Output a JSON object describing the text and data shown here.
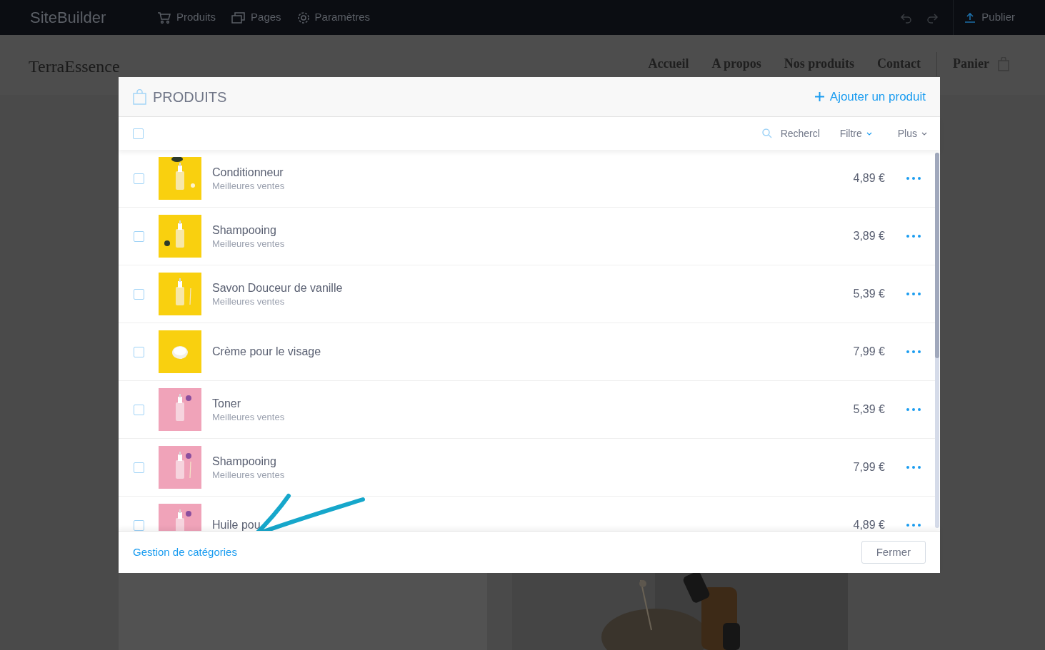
{
  "topbar": {
    "brand": "SiteBuilder",
    "menu": [
      {
        "kind": "cart",
        "label": "Produits"
      },
      {
        "kind": "pages",
        "label": "Pages"
      },
      {
        "kind": "gear",
        "label": "Paramètres"
      }
    ],
    "undo": {
      "disabled": true
    },
    "redo": {
      "disabled": true
    },
    "publish": "Publier"
  },
  "site": {
    "logo": "TerraEssence",
    "nav": [
      "Accueil",
      "A propos",
      "Nos produits",
      "Contact"
    ],
    "cart": "Panier"
  },
  "dialog": {
    "title": "PRODUITS",
    "add_button": "Ajouter un produit",
    "select_all": {
      "checked": false
    },
    "search": {
      "placeholder": "Rechercl"
    },
    "filter": "Filtre",
    "more": "Plus",
    "products": [
      {
        "name": "Conditionneur",
        "category": "Meilleures ventes",
        "price": "4,89 €",
        "checked": false
      },
      {
        "name": "Shampooing",
        "category": "Meilleures ventes",
        "price": "3,89 €",
        "checked": false
      },
      {
        "name": "Savon Douceur de vanille",
        "category": "Meilleures ventes",
        "price": "5,39 €",
        "checked": false
      },
      {
        "name": "Crème pour le visage",
        "price": "7,99 €",
        "checked": false
      },
      {
        "name": "Toner",
        "category": "Meilleures ventes",
        "price": "5,39 €",
        "checked": false
      },
      {
        "name": "Shampooing",
        "category": "Meilleures ventes",
        "price": "7,99 €",
        "checked": false
      },
      {
        "name": "Huile pou",
        "price": "4,89 €",
        "checked": false
      }
    ],
    "categories_link": "Gestion de catégories",
    "close_button": "Fermer"
  }
}
